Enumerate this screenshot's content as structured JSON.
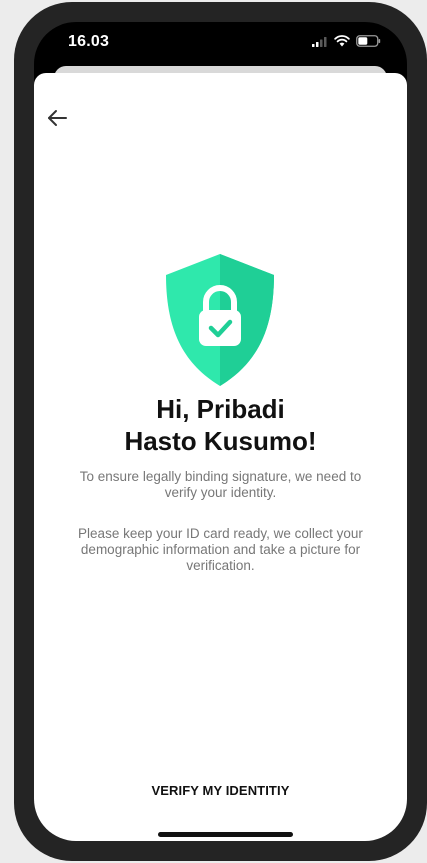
{
  "status_bar": {
    "time": "16.03",
    "icons": [
      "signal-icon",
      "wifi-icon",
      "battery-icon"
    ]
  },
  "header": {
    "back_icon": "arrow-left-icon"
  },
  "content": {
    "shield_icon": "shield-lock-check-icon",
    "greeting_line1": "Hi, Pribadi",
    "greeting_line2": "Hasto Kusumo!",
    "description_1": "To ensure legally binding signature, we need to verify your identity.",
    "description_2": "Please keep your ID card ready, we collect your demographic information and take a picture for verification."
  },
  "actions": {
    "verify_label": "VERIFY MY IDENTITIY"
  },
  "colors": {
    "shield_light": "#2fe8ac",
    "shield_dark": "#1fcf96",
    "background": "#ececec",
    "phone_frame": "#242424"
  }
}
